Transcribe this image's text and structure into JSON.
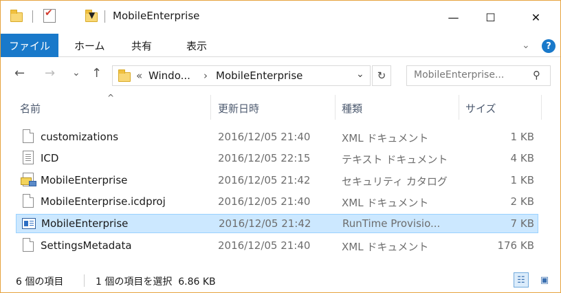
{
  "window": {
    "title": "MobileEnterprise",
    "controls": {
      "minimize": "—",
      "maximize": "☐",
      "close": "✕"
    }
  },
  "ribbon": {
    "tabs": [
      "ファイル",
      "ホーム",
      "共有",
      "表示"
    ],
    "help": "?"
  },
  "navigation": {
    "back": "←",
    "forward": "→",
    "recent": "⌄",
    "up": "↑",
    "address": {
      "overflow": "«",
      "crumbs": [
        "Windo...",
        "MobileEnterprise"
      ],
      "separator": "›"
    },
    "refresh": "↻",
    "search_placeholder": "MobileEnterprise...",
    "search_icon": "⚲"
  },
  "columns": {
    "name": "名前",
    "date": "更新日時",
    "type": "種類",
    "size": "サイズ"
  },
  "files": [
    {
      "name": "customizations",
      "date": "2016/12/05 21:40",
      "type": "XML ドキュメント",
      "size": "1 KB",
      "icon": "xml-document-icon",
      "selected": false
    },
    {
      "name": "ICD",
      "date": "2016/12/05 22:15",
      "type": "テキスト ドキュメント",
      "size": "4 KB",
      "icon": "text-document-icon",
      "selected": false
    },
    {
      "name": "MobileEnterprise",
      "date": "2016/12/05 21:42",
      "type": "セキュリティ カタログ",
      "size": "1 KB",
      "icon": "security-catalog-icon",
      "selected": false
    },
    {
      "name": "MobileEnterprise.icdproj",
      "date": "2016/12/05 21:40",
      "type": "XML ドキュメント",
      "size": "2 KB",
      "icon": "xml-document-icon",
      "selected": false
    },
    {
      "name": "MobileEnterprise",
      "date": "2016/12/05 21:42",
      "type": "RunTime Provisio...",
      "size": "7 KB",
      "icon": "provisioning-package-icon",
      "selected": true
    },
    {
      "name": "SettingsMetadata",
      "date": "2016/12/05 21:40",
      "type": "XML ドキュメント",
      "size": "176 KB",
      "icon": "xml-document-icon",
      "selected": false
    }
  ],
  "status": {
    "item_count": "6 個の項目",
    "selection": "1 個の項目を選択  6.86 KB"
  },
  "colors": {
    "accent": "#1979ca",
    "window_border": "#e6a23c",
    "selection_bg": "#cce8ff",
    "selection_border": "#99d1ff"
  }
}
